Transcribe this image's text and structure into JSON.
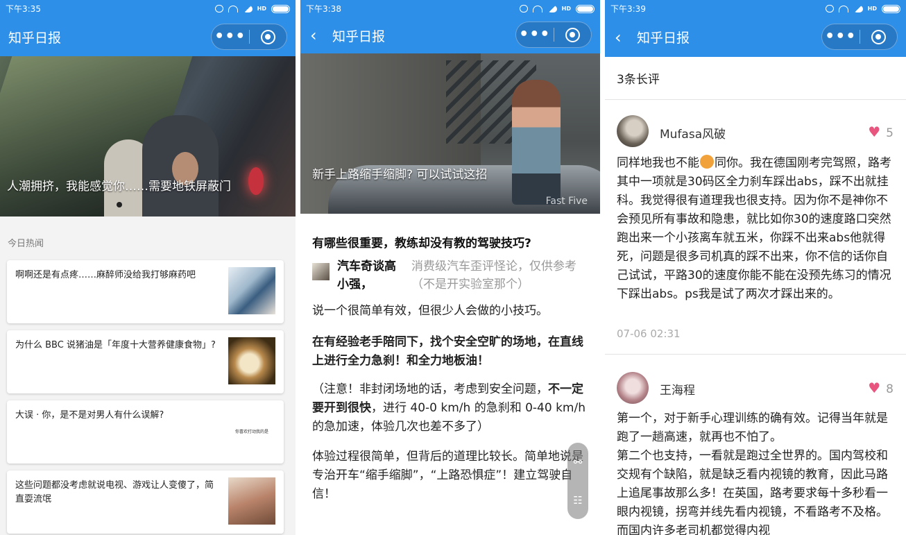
{
  "screen1": {
    "status_time": "下午3:35",
    "nav_title": "知乎日报",
    "hero_caption": "人潮拥挤，我能感觉你……需要地铁屏蔽门",
    "section_label": "今日热闻",
    "cards": [
      {
        "text": "啊啊还是有点疼……麻醉师没给我打够麻药吧"
      },
      {
        "text": "为什么 BBC 说猪油是「年度十大营养健康食物」?"
      },
      {
        "text": "大误 · 你，是不是对男人有什么误解?",
        "thumb_text": "你喜欢打动我的是"
      },
      {
        "text": "这些问题都没考虑就说电视、游戏让人变傻了，简直耍流氓"
      }
    ]
  },
  "screen2": {
    "status_time": "下午3:38",
    "nav_title": "知乎日报",
    "hero_caption": "新手上路缩手缩脚? 可以试试这招",
    "watermark": "Fast Five",
    "question_title": "有哪些很重要，教练却没有教的驾驶技巧?",
    "author_name": "汽车奇谈高小强，",
    "author_bio": "消费级汽车歪评怪论，仅供参考（不是开实验室那个）",
    "p1": "说一个很简单有效，但很少人会做的小技巧。",
    "p2": "在有经验老手陪同下，找个安全空旷的场地，在直线上进行全力急刹！和全力地板油！",
    "p3_a": "（注意！非封闭场地的话，考虑到安全问题，",
    "p3_b": "不一定要开到很快",
    "p3_c": "，进行 40-0 km/h 的急刹和 0-40 km/h 的急加速，体验几次也差不多了）",
    "p4": "体验过程很简单，但背后的道理比较长。简单地说是专治开车“缩手缩脚”，“上路恐惧症”！建立驾驶自信！"
  },
  "screen3": {
    "status_time": "下午3:39",
    "nav_title": "知乎日报",
    "review_count": "3条长评",
    "comments": [
      {
        "name": "Mufasa风破",
        "likes": "5",
        "body_a": "同样地我也不能",
        "body_b": "同你。我在德国刚考完驾照，路考其中一项就是30码区全力刹车踩出abs，踩不出就挂科。我觉得很有道理我也很支持。因为你不是神你不会预见所有事故和隐患，就比如你30的速度路口突然跑出来一个小孩离车就五米，你踩不出来abs他就得死，问题是很多司机真的踩不出来，你不信的话你自己试试，平路30的速度你能不能在没预先练习的情况下踩出abs。ps我是试了两次才踩出来的。",
        "time": "07-06 02:31"
      },
      {
        "name": "王海程",
        "likes": "8",
        "body": "第一个，对于新手心理训练的确有效。记得当年就是跑了一趟高速，就再也不怕了。\n第二个也支持，一看就是跑过全世界的。国内驾校和交规有个缺陷，就是缺乏看内视镜的教育，因此马路上追尾事故那么多！在英国，路考要求每十多秒看一眼内视镜，拐弯并线先看内视镜，不看路考不及格。而国内许多老司机都觉得内视"
      }
    ]
  }
}
